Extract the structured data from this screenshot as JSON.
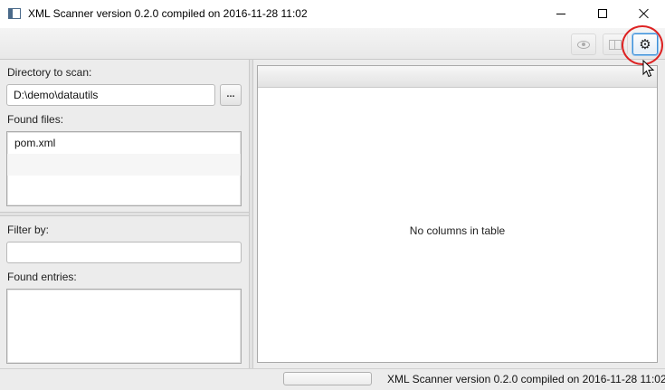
{
  "window": {
    "title": "XML Scanner version 0.2.0 compiled on 2016-11-28 11:02",
    "icon": "app-window-icon",
    "controls": [
      "minimize-icon",
      "maximize-icon",
      "close-icon"
    ]
  },
  "toolbar": {
    "buttons": [
      {
        "icon": "eye-icon",
        "enabled": false
      },
      {
        "icon": "columns-icon",
        "enabled": false
      },
      {
        "icon": "gear-icon",
        "glyph": "⚙",
        "enabled": true,
        "highlighted": true
      }
    ],
    "highlight_color": "#d22222"
  },
  "left": {
    "directory_label": "Directory to scan:",
    "directory_value": "D:\\demo\\datautils",
    "browse_label": "...",
    "found_files_label": "Found files:",
    "found_files": [
      "pom.xml"
    ],
    "filter_label": "Filter by:",
    "filter_value": "",
    "found_entries_label": "Found entries:",
    "found_entries": []
  },
  "table": {
    "empty_message": "No columns in table"
  },
  "status": {
    "progress": 0,
    "text": "XML Scanner version 0.2.0 compiled on 2016-11-28 11:02"
  }
}
